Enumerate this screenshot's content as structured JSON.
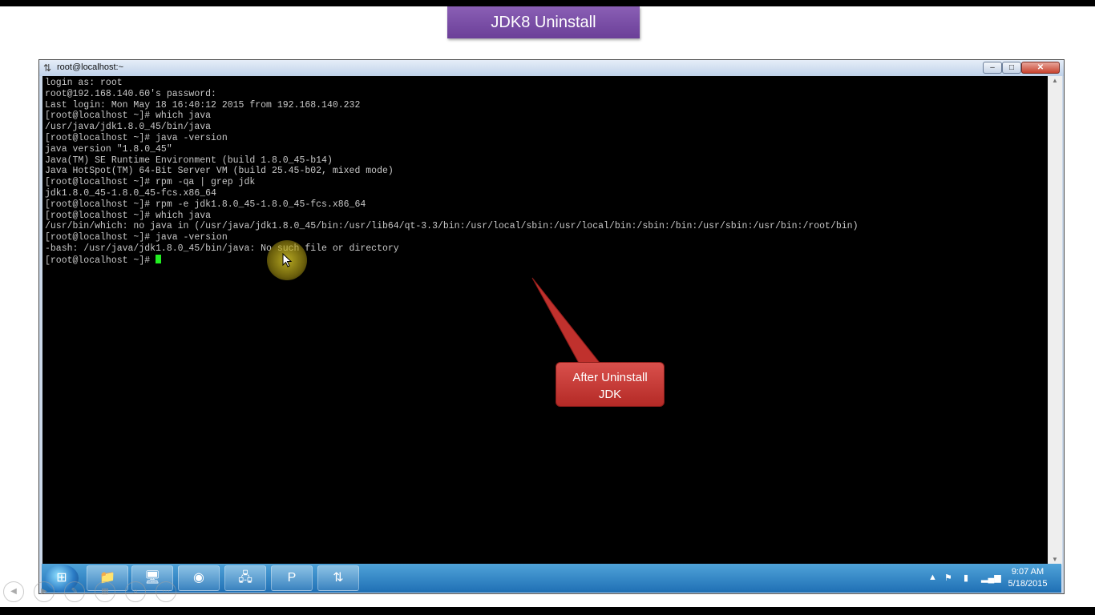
{
  "slide": {
    "title": "JDK8 Uninstall"
  },
  "window": {
    "title": "root@localhost:~",
    "icon": "putty-icon",
    "controls": {
      "minimize": "–",
      "maximize": "□",
      "close": "✕"
    }
  },
  "terminal": {
    "lines": [
      "login as: root",
      "root@192.168.140.60's password:",
      "Last login: Mon May 18 16:40:12 2015 from 192.168.140.232",
      "[root@localhost ~]# which java",
      "/usr/java/jdk1.8.0_45/bin/java",
      "[root@localhost ~]# java -version",
      "java version \"1.8.0_45\"",
      "Java(TM) SE Runtime Environment (build 1.8.0_45-b14)",
      "Java HotSpot(TM) 64-Bit Server VM (build 25.45-b02, mixed mode)",
      "[root@localhost ~]# rpm -qa | grep jdk",
      "jdk1.8.0_45-1.8.0_45-fcs.x86_64",
      "[root@localhost ~]# rpm -e jdk1.8.0_45-1.8.0_45-fcs.x86_64",
      "[root@localhost ~]# which java",
      "/usr/bin/which: no java in (/usr/java/jdk1.8.0_45/bin:/usr/lib64/qt-3.3/bin:/usr/local/sbin:/usr/local/bin:/sbin:/bin:/usr/sbin:/usr/bin:/root/bin)",
      "[root@localhost ~]# java -version",
      "-bash: /usr/java/jdk1.8.0_45/bin/java: No such file or directory"
    ],
    "prompt": "[root@localhost ~]# ",
    "cursor_color": "#22ee22"
  },
  "callout": {
    "line1": "After Uninstall",
    "line2": "JDK",
    "color": "#c0312d"
  },
  "taskbar": {
    "start_icon": "windows-start-icon",
    "apps": [
      {
        "name": "file-explorer-icon",
        "glyph": "📁"
      },
      {
        "name": "computer-management-icon",
        "glyph": "🖥"
      },
      {
        "name": "chrome-icon",
        "glyph": "◉"
      },
      {
        "name": "remote-desktop-icon",
        "glyph": "🖧"
      },
      {
        "name": "powerpoint-icon",
        "glyph": "P"
      },
      {
        "name": "putty-icon",
        "glyph": "⇅"
      }
    ],
    "tray": {
      "time": "9:07 AM",
      "date": "5/18/2015",
      "icons": [
        "show-hidden-icons-arrow",
        "action-center-flag-icon",
        "battery-icon",
        "network-signal-icon"
      ]
    }
  },
  "slideshow_nav": [
    "previous-icon",
    "next-icon",
    "pen-icon",
    "slides-icon",
    "zoom-icon",
    "more-options-icon"
  ]
}
